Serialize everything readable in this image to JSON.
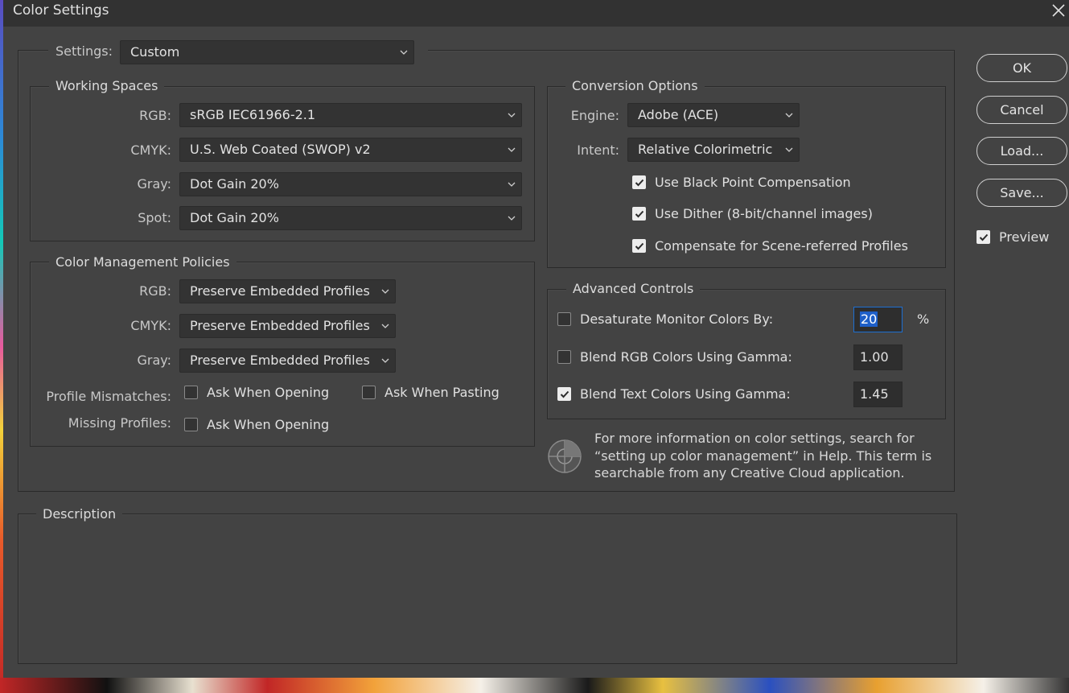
{
  "window": {
    "title": "Color Settings"
  },
  "settings": {
    "label": "Settings:",
    "value": "Custom"
  },
  "working_spaces": {
    "legend": "Working Spaces",
    "rows": [
      {
        "label": "RGB:",
        "value": "sRGB IEC61966-2.1"
      },
      {
        "label": "CMYK:",
        "value": "U.S. Web Coated (SWOP) v2"
      },
      {
        "label": "Gray:",
        "value": "Dot Gain 20%"
      },
      {
        "label": "Spot:",
        "value": "Dot Gain 20%"
      }
    ]
  },
  "policies": {
    "legend": "Color Management Policies",
    "rows": [
      {
        "label": "RGB:",
        "value": "Preserve Embedded Profiles"
      },
      {
        "label": "CMYK:",
        "value": "Preserve Embedded Profiles"
      },
      {
        "label": "Gray:",
        "value": "Preserve Embedded Profiles"
      }
    ],
    "profile_mismatches": {
      "label": "Profile Mismatches:",
      "ask_opening": {
        "label": "Ask When Opening",
        "checked": false
      },
      "ask_pasting": {
        "label": "Ask When Pasting",
        "checked": false
      }
    },
    "missing_profiles": {
      "label": "Missing Profiles:",
      "ask_opening": {
        "label": "Ask When Opening",
        "checked": false
      }
    }
  },
  "conversion": {
    "legend": "Conversion Options",
    "engine": {
      "label": "Engine:",
      "value": "Adobe (ACE)"
    },
    "intent": {
      "label": "Intent:",
      "value": "Relative Colorimetric"
    },
    "black_point": {
      "label": "Use Black Point Compensation",
      "checked": true
    },
    "dither": {
      "label": "Use Dither (8-bit/channel images)",
      "checked": true
    },
    "scene_referred": {
      "label": "Compensate for Scene-referred Profiles",
      "checked": true
    }
  },
  "advanced": {
    "legend": "Advanced Controls",
    "desaturate": {
      "label": "Desaturate Monitor Colors By:",
      "checked": false,
      "value": "20",
      "unit": "%"
    },
    "blend_rgb": {
      "label": "Blend RGB Colors Using Gamma:",
      "checked": false,
      "value": "1.00"
    },
    "blend_text": {
      "label": "Blend Text Colors Using Gamma:",
      "checked": true,
      "value": "1.45"
    }
  },
  "info": {
    "icon": "color-wheel-icon",
    "line1": "For more information on color settings, search for",
    "line2": "“setting up color management” in Help. This term is",
    "line3": "searchable from any Creative Cloud application."
  },
  "description": {
    "legend": "Description"
  },
  "buttons": {
    "ok": "OK",
    "cancel": "Cancel",
    "load": "Load...",
    "save": "Save..."
  },
  "preview": {
    "label": "Preview",
    "checked": true
  },
  "colors": {
    "dialog_bg": "#434343",
    "titlebar_bg": "#323232",
    "focus": "#1d6fd1"
  }
}
